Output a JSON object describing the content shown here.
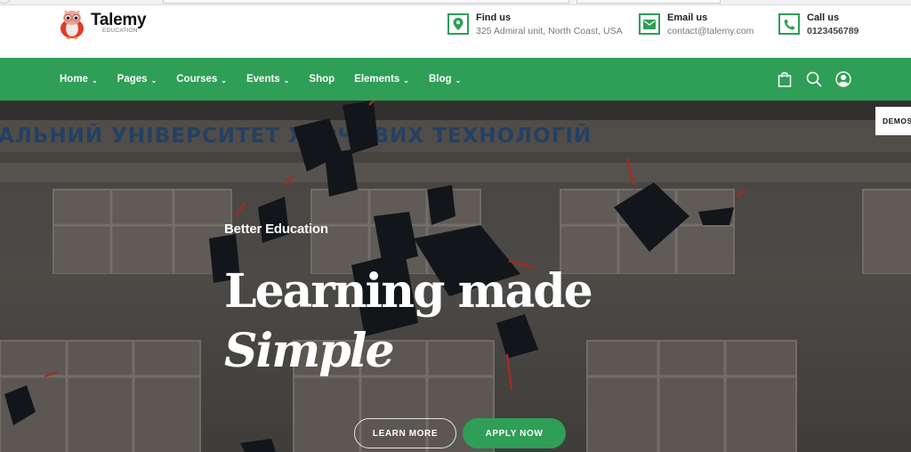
{
  "brand": {
    "name": "Talemy",
    "tagline": "EDUCATION",
    "logo_icon": "owl-logo-icon"
  },
  "contact": [
    {
      "icon": "map-pin-icon",
      "title": "Find us",
      "text": "325 Admiral unit, North Coast, USA"
    },
    {
      "icon": "envelope-icon",
      "title": "Email us",
      "text": "contact@talemy.com"
    },
    {
      "icon": "phone-icon",
      "title": "Call us",
      "text": "0123456789"
    }
  ],
  "nav": {
    "items": [
      {
        "label": "Home",
        "has_dropdown": true
      },
      {
        "label": "Pages",
        "has_dropdown": true
      },
      {
        "label": "Courses",
        "has_dropdown": true
      },
      {
        "label": "Events",
        "has_dropdown": true
      },
      {
        "label": "Shop",
        "has_dropdown": false
      },
      {
        "label": "Elements",
        "has_dropdown": true
      },
      {
        "label": "Blog",
        "has_dropdown": true
      }
    ],
    "chevron": "⌄",
    "icons": [
      "shopping-bag-icon",
      "search-icon",
      "user-account-icon"
    ]
  },
  "hero": {
    "eyebrow": "Better Education",
    "headline_line1": "Learning made",
    "headline_line2": "Simple",
    "building_sign": "АЛЬНИЙ УНІВЕРСИТЕТ ХАРЧОВИХ ТЕХНОЛОГІЙ",
    "buttons": {
      "learn_more": "LEARN MORE",
      "apply_now": "APPLY NOW"
    },
    "demos_tab": "DEMOS"
  },
  "colors": {
    "accent": "#2f9e57",
    "header_bg": "#ffffff",
    "text_dark": "#222222",
    "text_muted": "#777777"
  }
}
